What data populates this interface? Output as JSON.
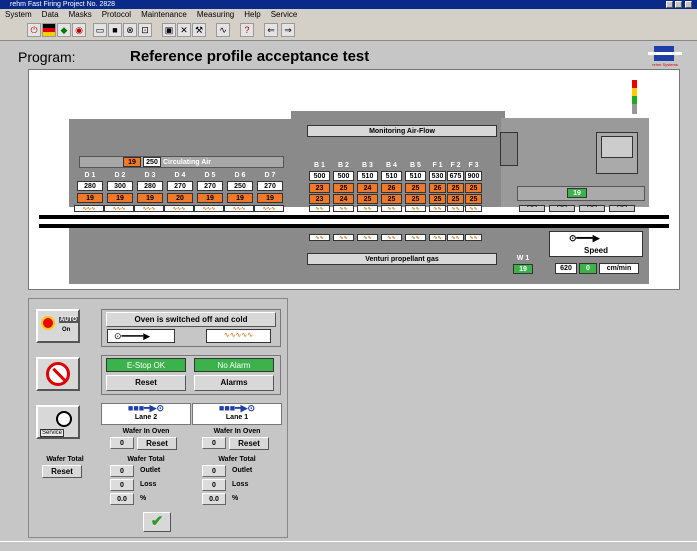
{
  "window": {
    "title": "rehm Fast Firing  Project No. 2828"
  },
  "menu": [
    "System",
    "Data",
    "Masks",
    "Protocol",
    "Maintenance",
    "Measuring",
    "Help",
    "Service"
  ],
  "toolbar_icons": [
    "stop-icon",
    "flag-de-icon",
    "flag-other-icon",
    "flag-icon",
    "open-folder-icon",
    "save-icon",
    "settings-icon",
    "tool-icon",
    "screen-icon",
    "tools-icon",
    "graph-icon",
    "help-icon",
    "back-arrow-icon",
    "forward-arrow-icon"
  ],
  "header": {
    "label": "Program:",
    "program_name": "Reference profile acceptance test",
    "logo_text": "rehm Systems"
  },
  "oven": {
    "circ_air": {
      "value1": "19",
      "value2": "250",
      "label": "Circulating Air"
    },
    "drier_zones": [
      {
        "name": "D 1",
        "set": "280",
        "actual": "19"
      },
      {
        "name": "D 2",
        "set": "300",
        "actual": "19"
      },
      {
        "name": "D 3",
        "set": "280",
        "actual": "19"
      },
      {
        "name": "D 4",
        "set": "270",
        "actual": "20"
      },
      {
        "name": "D 5",
        "set": "270",
        "actual": "19"
      },
      {
        "name": "D 6",
        "set": "250",
        "actual": "19"
      },
      {
        "name": "D 7",
        "set": "270",
        "actual": "19"
      }
    ],
    "monitoring_label": "Monitoring Air-Flow",
    "fire_zones": [
      {
        "name": "B 1",
        "set": "500",
        "actual1": "23",
        "actual2": "23"
      },
      {
        "name": "B 2",
        "set": "500",
        "actual1": "25",
        "actual2": "24"
      },
      {
        "name": "B 3",
        "set": "510",
        "actual1": "24",
        "actual2": "25"
      },
      {
        "name": "B 4",
        "set": "510",
        "actual1": "26",
        "actual2": "25"
      },
      {
        "name": "B 5",
        "set": "510",
        "actual1": "25",
        "actual2": "25"
      },
      {
        "name": "F 1",
        "set": "530",
        "actual1": "26",
        "actual2": "25"
      },
      {
        "name": "F 2",
        "set": "675",
        "actual1": "25",
        "actual2": "25"
      },
      {
        "name": "F 3",
        "set": "900",
        "actual1": "25",
        "actual2": "25"
      }
    ],
    "venturi_label": "Venturi propellant gas",
    "cooling_value": "19",
    "w1": {
      "name": "W 1",
      "value": "19"
    },
    "speed": {
      "label": "Speed",
      "set": "620",
      "actual": "0",
      "unit": "cm/min"
    }
  },
  "control": {
    "auto_label": "AUTO",
    "on_label": "On",
    "oven_status": "Oven is switched off and cold",
    "estop": "E-Stop OK",
    "alarm_status": "No Alarm",
    "reset_label": "Reset",
    "alarms_label": "Alarms",
    "service_label": "Service",
    "lane2": {
      "title": "Lane 2",
      "wafer_in_oven_label": "Wafer In Oven",
      "wafer_in_oven": "0",
      "reset": "Reset",
      "wafer_total_label": "Wafer Total",
      "outlet": "0",
      "outlet_label": "Outlet",
      "loss": "0",
      "loss_label": "Loss",
      "pct": "0.0",
      "pct_label": "%"
    },
    "lane1": {
      "title": "Lane 1",
      "wafer_in_oven_label": "Wafer In Oven",
      "wafer_in_oven": "0",
      "reset": "Reset",
      "wafer_total_label": "Wafer Total",
      "outlet": "0",
      "outlet_label": "Outlet",
      "loss": "0",
      "loss_label": "Loss",
      "pct": "0.0",
      "pct_label": "%"
    },
    "wafer_total_label": "Wafer Total",
    "wafer_total_reset": "Reset"
  },
  "colors": {
    "accent_green": "#3bb34a",
    "accent_orange": "#f0782a",
    "title_blue": "#0a2a8a"
  }
}
